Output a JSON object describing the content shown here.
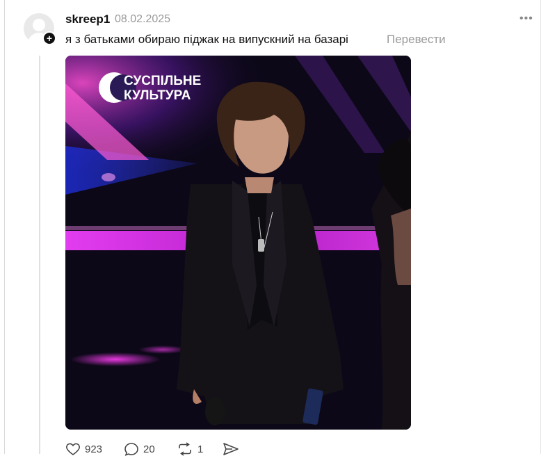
{
  "post": {
    "username": "skreep1",
    "date": "08.02.2025",
    "text": "я з батьками обираю піджак на випускний на базарі",
    "translate_label": "Перевести",
    "follow_symbol": "+",
    "more_label": "•••"
  },
  "media": {
    "logo_line1": "СУСПІЛЬНЕ",
    "logo_line2": "КУЛЬТУРА"
  },
  "actions": {
    "likes": "923",
    "comments": "20",
    "reposts": "1"
  },
  "icons": {
    "like": "heart-icon",
    "comment": "comment-icon",
    "repost": "repost-icon",
    "share": "share-icon",
    "more": "more-icon",
    "follow": "plus-icon"
  }
}
